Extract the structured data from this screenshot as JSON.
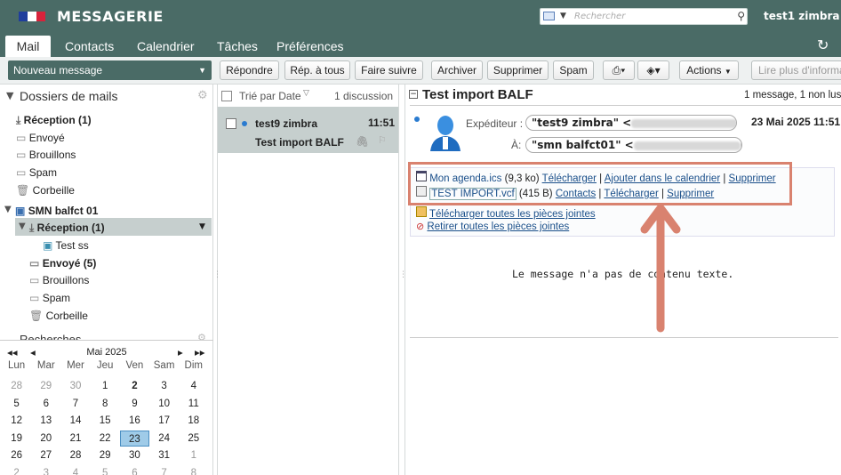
{
  "app": {
    "title": "MESSAGERIE",
    "user": "test1 zimbra"
  },
  "search": {
    "placeholder": "Rechercher"
  },
  "tabs": [
    {
      "label": "Mail"
    },
    {
      "label": "Contacts"
    },
    {
      "label": "Calendrier"
    },
    {
      "label": "Tâches"
    },
    {
      "label": "Préférences"
    }
  ],
  "toolbar": {
    "new_message": "Nouveau message",
    "reply": "Répondre",
    "reply_all": "Rép. à tous",
    "forward": "Faire suivre",
    "archive": "Archiver",
    "delete": "Supprimer",
    "spam": "Spam",
    "actions": "Actions",
    "read_more": "Lire plus d'informa"
  },
  "folders": {
    "header": "Dossiers de mails",
    "items": [
      {
        "label": "Réception (1)"
      },
      {
        "label": "Envoyé"
      },
      {
        "label": "Brouillons"
      },
      {
        "label": "Spam"
      },
      {
        "label": "Corbeille"
      }
    ],
    "shared": {
      "label": "SMN balfct 01",
      "items": [
        {
          "label": "Réception (1)"
        },
        {
          "label": "Test ss"
        },
        {
          "label": "Envoyé (5)"
        },
        {
          "label": "Brouillons"
        },
        {
          "label": "Spam"
        },
        {
          "label": "Corbeille"
        }
      ]
    },
    "searches_label": "Recherches"
  },
  "calendar": {
    "month": "Mai 2025",
    "days": [
      "Lun",
      "Mar",
      "Mer",
      "Jeu",
      "Ven",
      "Sam",
      "Dim"
    ],
    "weeks": [
      [
        "28",
        "29",
        "30",
        "1",
        "2",
        "3",
        "4"
      ],
      [
        "5",
        "6",
        "7",
        "8",
        "9",
        "10",
        "11"
      ],
      [
        "12",
        "13",
        "14",
        "15",
        "16",
        "17",
        "18"
      ],
      [
        "19",
        "20",
        "21",
        "22",
        "23",
        "24",
        "25"
      ],
      [
        "26",
        "27",
        "28",
        "29",
        "30",
        "31",
        "1"
      ],
      [
        "2",
        "3",
        "4",
        "5",
        "6",
        "7",
        "8"
      ]
    ],
    "today": "23"
  },
  "list": {
    "sort": "Trié par Date",
    "count": "1 discussion",
    "item": {
      "from": "test9 zimbra",
      "time": "11:51",
      "subject": "Test import BALF"
    }
  },
  "message": {
    "subject": "Test import BALF",
    "count": "1 message, 1 non lus",
    "from_label": "Expéditeur :",
    "from": "\"test9 zimbra\" <",
    "to_label": "À:",
    "to": "\"smn balfct01\" <",
    "date": "23 Mai 2025 11:51",
    "attachments": [
      {
        "name": "Mon agenda.ics",
        "size": "(9,3 ko)",
        "actions": [
          "Télécharger",
          "Ajouter dans le calendrier",
          "Supprimer"
        ]
      },
      {
        "name": "TEST IMPORT.vcf",
        "size": "(415 B)",
        "actions": [
          "Contacts",
          "Télécharger",
          "Supprimer"
        ]
      }
    ],
    "download_all": "Télécharger toutes les pièces jointes",
    "remove_all": "Retirer toutes les pièces jointes",
    "body": "Le message n'a pas de contenu texte."
  },
  "colors": {
    "header": "#4a6b66",
    "highlight": "#d9826f",
    "accent": "#2a7bd0"
  }
}
